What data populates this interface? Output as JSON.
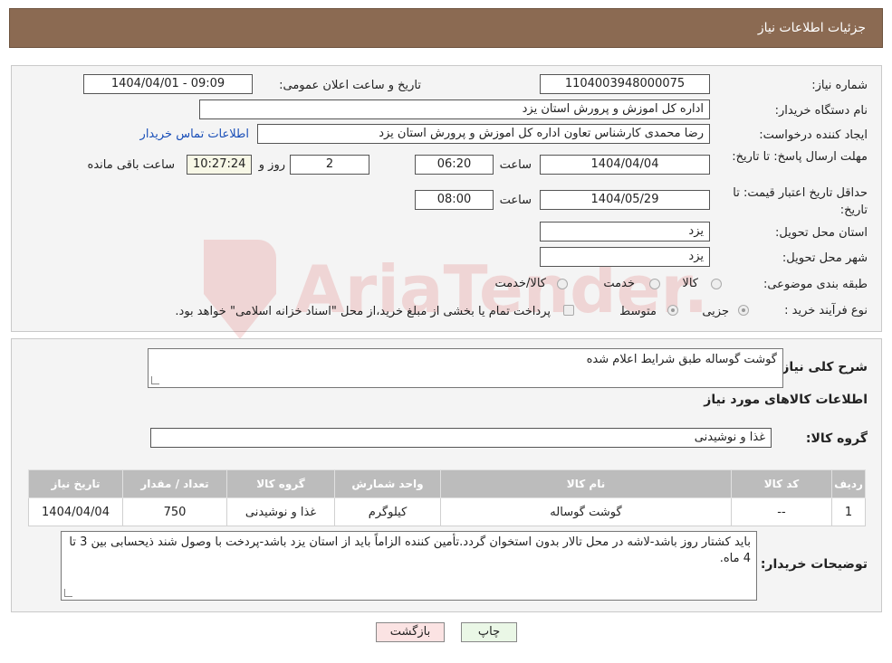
{
  "header": {
    "title": "جزئیات اطلاعات نیاز"
  },
  "form": {
    "need_number_label": "شماره نیاز:",
    "need_number": "1104003948000075",
    "announce_label": "تاریخ و ساعت اعلان عمومی:",
    "announce_value": "1404/04/01 - 09:09",
    "buyer_org_label": "نام دستگاه خریدار:",
    "buyer_org": "اداره کل اموزش و پرورش استان یزد",
    "requester_label": "ایجاد کننده درخواست:",
    "requester": "رضا محمدی کارشناس تعاون اداره کل اموزش و پرورش استان یزد",
    "contact_link": "اطلاعات تماس خریدار",
    "deadline_label": "مهلت ارسال پاسخ: تا تاریخ:",
    "deadline_date": "1404/04/04",
    "time_label": "ساعت",
    "deadline_time": "06:20",
    "days_value": "2",
    "days_label": "روز و",
    "remaining_time": "10:27:24",
    "remaining_label": "ساعت باقی مانده",
    "validity_label": "حداقل تاریخ اعتبار قیمت: تا تاریخ:",
    "validity_date": "1404/05/29",
    "validity_time": "08:00",
    "province_label": "استان محل تحویل:",
    "province": "یزد",
    "city_label": "شهر محل تحویل:",
    "city": "یزد",
    "category_label": "طبقه بندی موضوعی:",
    "category_options": [
      "کالا",
      "خدمت",
      "کالا/خدمت"
    ],
    "purchase_type_label": "نوع فرآیند خرید :",
    "purchase_options": [
      "جزیی",
      "متوسط"
    ],
    "purchase_note": "پرداخت تمام یا بخشی از مبلغ خرید،از محل \"اسناد خزانه اسلامی\" خواهد بود."
  },
  "details": {
    "summary_label": "شرح کلی نیاز:",
    "summary_value": "گوشت گوساله طبق شرایط اعلام شده",
    "goods_info_title": "اطلاعات کالاهای مورد نیاز",
    "goods_group_label": "گروه کالا:",
    "goods_group_value": "غذا و نوشیدنی",
    "table": {
      "headers": [
        "ردیف",
        "کد کالا",
        "نام کالا",
        "واحد شمارش",
        "گروه کالا",
        "تعداد / مقدار",
        "تاریخ نیاز"
      ],
      "rows": [
        [
          "1",
          "--",
          "گوشت گوساله",
          "کیلوگرم",
          "غذا و نوشیدنی",
          "750",
          "1404/04/04"
        ]
      ]
    },
    "buyer_notes_label": "توضیحات خریدار:",
    "buyer_notes": "باید کشتار روز باشد-لاشه در محل تالار بدون استخوان گردد.تأمین کننده الزاماً باید از استان یزد باشد-پردخت با وصول شند ذیحسابی بین 3 تا 4 ماه."
  },
  "buttons": {
    "print": "چاپ",
    "back": "بازگشت"
  },
  "colors": {
    "title_bar": "#8b6a52",
    "print_btn": "#eaf7e6",
    "back_btn": "#fbe3e3"
  }
}
